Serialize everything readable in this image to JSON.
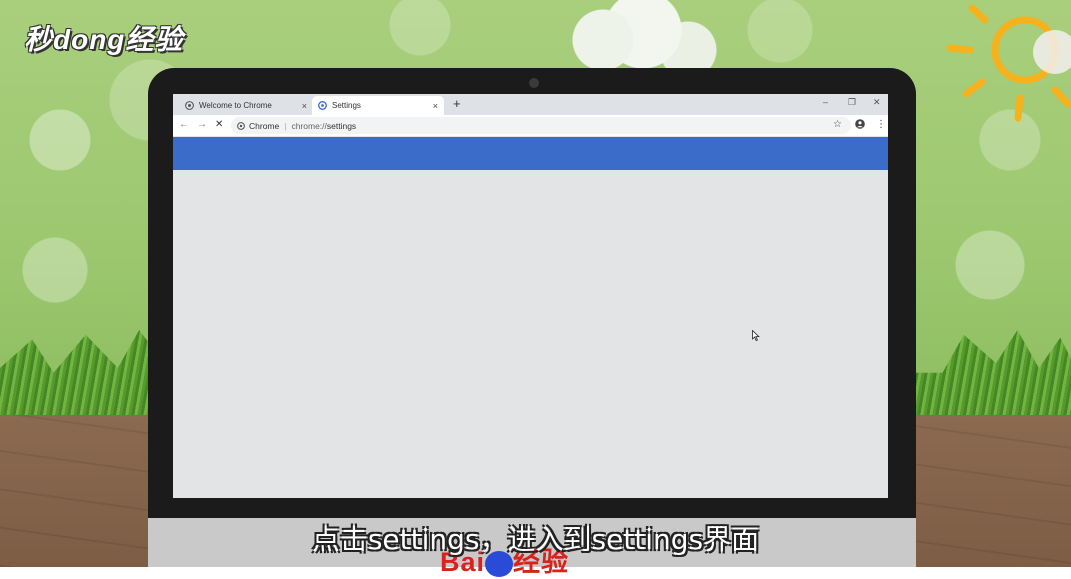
{
  "overlay": {
    "logo_text": "秒dong经验",
    "subtitle": "点击settings，进入到settings界面",
    "watermark_text": "Bai",
    "watermark_suffix": "经验"
  },
  "browser": {
    "tabs": [
      {
        "title": "Welcome to Chrome",
        "icon": "chrome-icon",
        "active": false,
        "close": "×"
      },
      {
        "title": "Settings",
        "icon": "settings-favicon",
        "active": true,
        "close": "×"
      }
    ],
    "new_tab": "+",
    "window_controls": {
      "minimize": "–",
      "restore": "❐",
      "close": "✕"
    },
    "nav": {
      "back": "←",
      "forward": "→",
      "stop": "✕"
    },
    "address": {
      "site_label": "Chrome",
      "scheme": "chrome://",
      "path": "settings"
    },
    "toolbar_right": {
      "bookmark": "☆",
      "menu": "⋮"
    },
    "header_color": "#3b6cc9",
    "page_color": "#e3e4e6"
  }
}
